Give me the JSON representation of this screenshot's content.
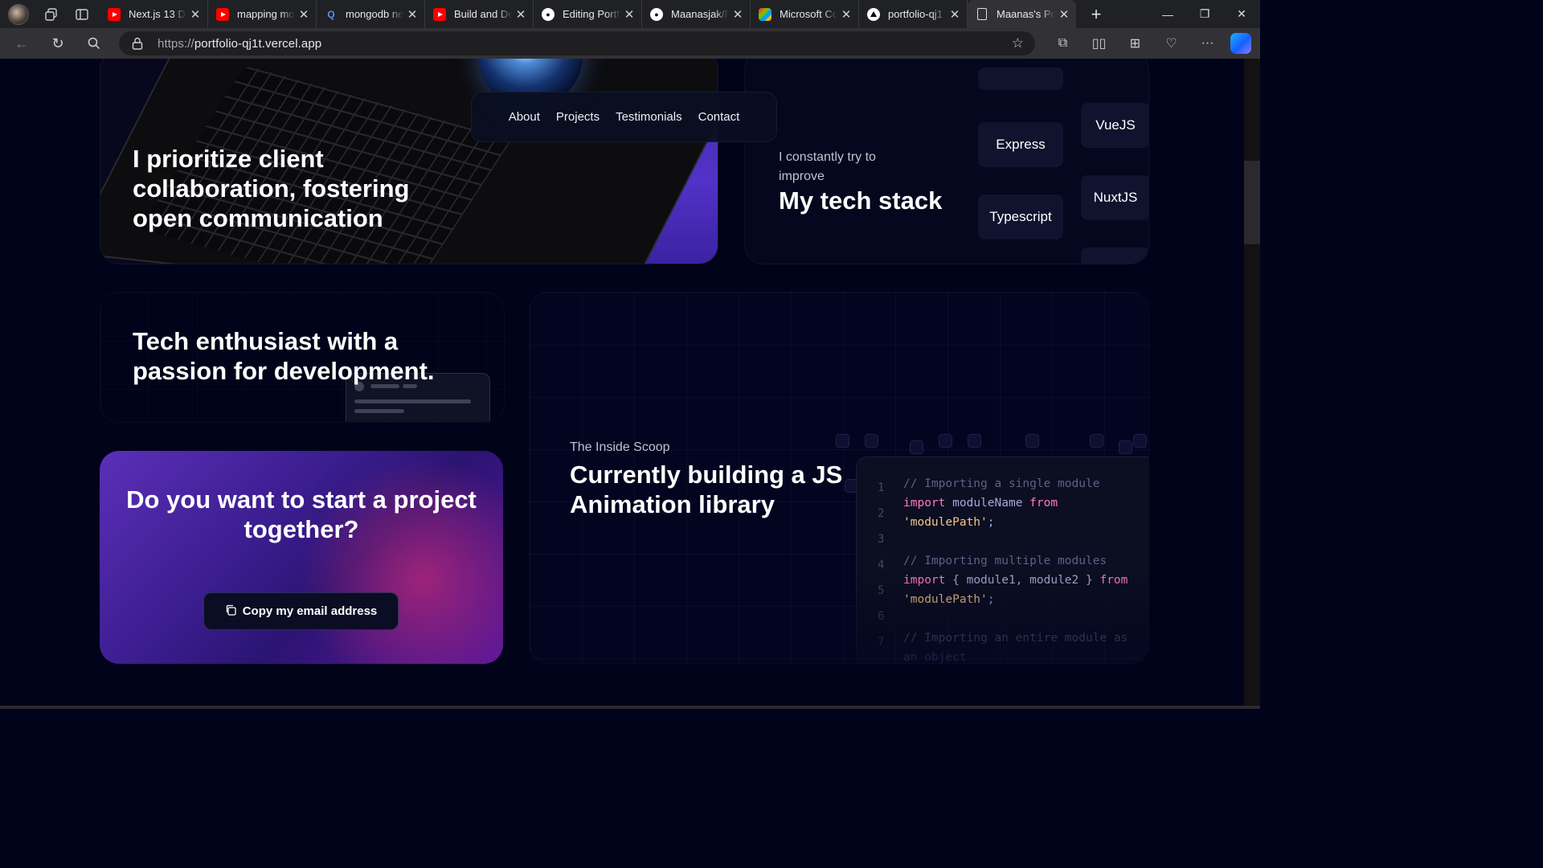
{
  "browser": {
    "tabs": [
      {
        "title": "Next.js 13 D",
        "favicon": "youtube-icon"
      },
      {
        "title": "mapping mo",
        "favicon": "youtube-icon"
      },
      {
        "title": "mongodb ne",
        "favicon": "search-icon"
      },
      {
        "title": "Build and De",
        "favicon": "youtube-icon"
      },
      {
        "title": "Editing Portf",
        "favicon": "github-icon"
      },
      {
        "title": "Maanasjak/P",
        "favicon": "github-icon"
      },
      {
        "title": "Microsoft Co",
        "favicon": "microsoft-icon"
      },
      {
        "title": "portfolio-qj1",
        "favicon": "vercel-icon"
      },
      {
        "title": "Maanas's Po",
        "favicon": "document-icon",
        "active": true
      }
    ],
    "url_scheme": "https://",
    "url_host": "portfolio-qj1t.vercel.app"
  },
  "nav": {
    "items": [
      "About",
      "Projects",
      "Testimonials",
      "Contact"
    ]
  },
  "cards": {
    "collab_title": "I prioritize client collaboration, fostering open communication",
    "tech": {
      "subtitle": "I constantly try to improve",
      "title": "My tech stack",
      "col1": [
        "Express",
        "Typescript"
      ],
      "col2": [
        "VueJS",
        "NuxtJS"
      ]
    },
    "enthusiast_title": "Tech enthusiast with a passion for development.",
    "cta": {
      "title": "Do you want to start a project together?",
      "button_label": "Copy my email address"
    },
    "animation": {
      "subtitle": "The Inside Scoop",
      "title": "Currently building a JS Animation library",
      "line_numbers": [
        "1",
        "2",
        "3",
        "4",
        "5",
        "6",
        "7"
      ],
      "code": {
        "c1": "// Importing a single module",
        "kw_import": "import",
        "module_name": "moduleName",
        "kw_from": "from",
        "path": "'modulePath'",
        "semi": ";",
        "c2": "// Importing multiple modules",
        "modules": "{ module1, module2 }",
        "c3": "// Importing an entire module as",
        "c4": "an object"
      }
    }
  },
  "colors": {
    "page_bg": "#000319",
    "card_bg": "#04071d",
    "cta_gradient_start": "#5b2fb8",
    "cta_gradient_end": "#5a179a",
    "code_keyword": "#ff79c6",
    "code_string": "#f1c887",
    "code_comment": "#5b6189"
  }
}
